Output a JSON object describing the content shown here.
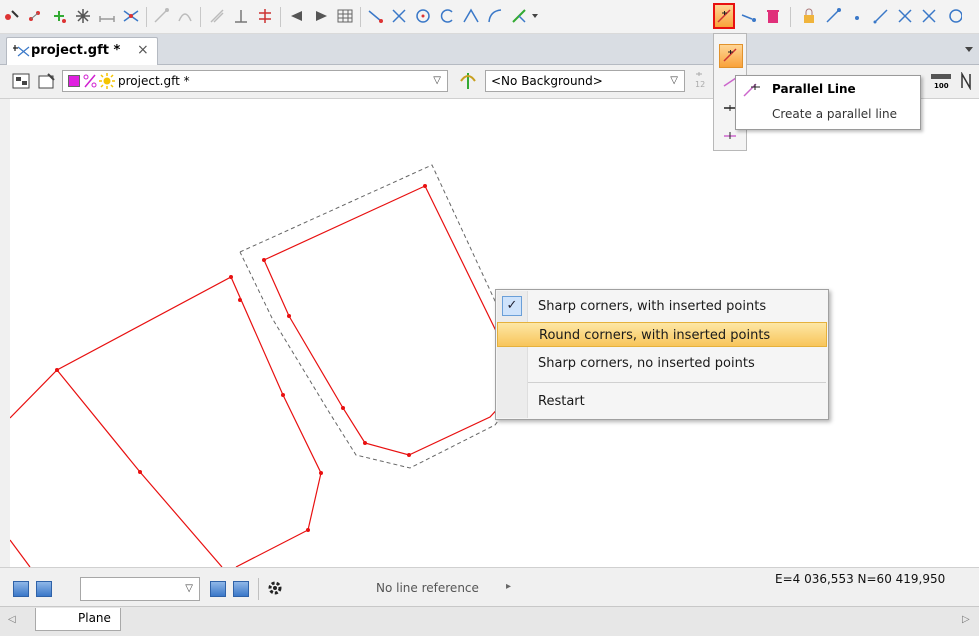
{
  "document_tab": {
    "label": "project.gft *",
    "close": "×"
  },
  "layer_combo": {
    "value": "project.gft *"
  },
  "background_combo": {
    "value": "<No Background>"
  },
  "tool_tooltip": {
    "title": "Parallel Line",
    "description": "Create a parallel line"
  },
  "context_menu": {
    "items": [
      {
        "label": "Sharp corners, with inserted points",
        "checked": true
      },
      {
        "label": "Round corners, with inserted points",
        "highlighted": true
      },
      {
        "label": "Sharp corners, no inserted points"
      },
      {
        "label": "Restart"
      }
    ],
    "check_glyph": "✓"
  },
  "status": {
    "line_reference": "No line reference",
    "coordinates": "E=4 036,553  N=60 419,950"
  },
  "bottom_tabs": [
    {
      "label": "Plane"
    }
  ],
  "scale_label": "100",
  "colors": {
    "accent_red": "#e81010",
    "highlight": "#f8c55b",
    "nav_blue": "#3b78c8"
  }
}
